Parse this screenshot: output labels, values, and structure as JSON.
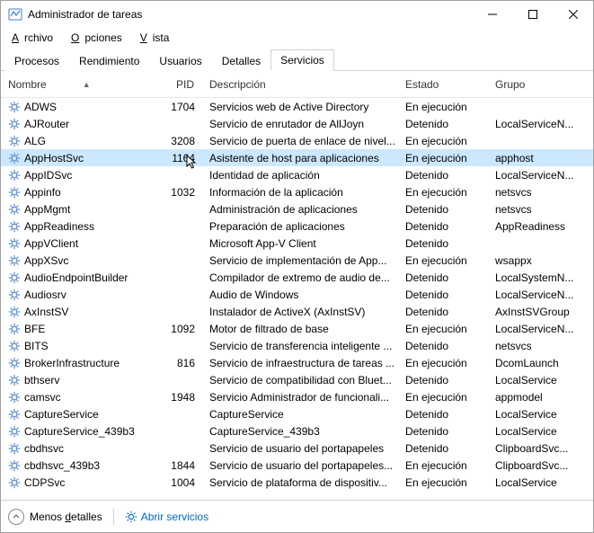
{
  "window": {
    "title": "Administrador de tareas"
  },
  "menu": {
    "file": "Archivo",
    "options": "Opciones",
    "view": "Vista"
  },
  "tabs": {
    "processes": "Procesos",
    "performance": "Rendimiento",
    "users": "Usuarios",
    "details": "Detalles",
    "services": "Servicios"
  },
  "columns": {
    "name": "Nombre",
    "pid": "PID",
    "description": "Descripción",
    "status": "Estado",
    "group": "Grupo"
  },
  "services": [
    {
      "name": "ADWS",
      "pid": "1704",
      "desc": "Servicios web de Active Directory",
      "status": "En ejecución",
      "group": ""
    },
    {
      "name": "AJRouter",
      "pid": "",
      "desc": "Servicio de enrutador de AllJoyn",
      "status": "Detenido",
      "group": "LocalServiceN..."
    },
    {
      "name": "ALG",
      "pid": "3208",
      "desc": "Servicio de puerta de enlace de nivel...",
      "status": "En ejecución",
      "group": ""
    },
    {
      "name": "AppHostSvc",
      "pid": "1164",
      "desc": "Asistente de host para aplicaciones",
      "status": "En ejecución",
      "group": "apphost",
      "selected": true
    },
    {
      "name": "AppIDSvc",
      "pid": "",
      "desc": "Identidad de aplicación",
      "status": "Detenido",
      "group": "LocalServiceN..."
    },
    {
      "name": "Appinfo",
      "pid": "1032",
      "desc": "Información de la aplicación",
      "status": "En ejecución",
      "group": "netsvcs"
    },
    {
      "name": "AppMgmt",
      "pid": "",
      "desc": "Administración de aplicaciones",
      "status": "Detenido",
      "group": "netsvcs"
    },
    {
      "name": "AppReadiness",
      "pid": "",
      "desc": "Preparación de aplicaciones",
      "status": "Detenido",
      "group": "AppReadiness"
    },
    {
      "name": "AppVClient",
      "pid": "",
      "desc": "Microsoft App-V Client",
      "status": "Detenido",
      "group": ""
    },
    {
      "name": "AppXSvc",
      "pid": "",
      "desc": "Servicio de implementación de App...",
      "status": "En ejecución",
      "group": "wsappx"
    },
    {
      "name": "AudioEndpointBuilder",
      "pid": "",
      "desc": "Compilador de extremo de audio de...",
      "status": "Detenido",
      "group": "LocalSystemN..."
    },
    {
      "name": "Audiosrv",
      "pid": "",
      "desc": "Audio de Windows",
      "status": "Detenido",
      "group": "LocalServiceN..."
    },
    {
      "name": "AxInstSV",
      "pid": "",
      "desc": "Instalador de ActiveX (AxInstSV)",
      "status": "Detenido",
      "group": "AxInstSVGroup"
    },
    {
      "name": "BFE",
      "pid": "1092",
      "desc": "Motor de filtrado de base",
      "status": "En ejecución",
      "group": "LocalServiceN..."
    },
    {
      "name": "BITS",
      "pid": "",
      "desc": "Servicio de transferencia inteligente ...",
      "status": "Detenido",
      "group": "netsvcs"
    },
    {
      "name": "BrokerInfrastructure",
      "pid": "816",
      "desc": "Servicio de infraestructura de tareas ...",
      "status": "En ejecución",
      "group": "DcomLaunch"
    },
    {
      "name": "bthserv",
      "pid": "",
      "desc": "Servicio de compatibilidad con Bluet...",
      "status": "Detenido",
      "group": "LocalService"
    },
    {
      "name": "camsvc",
      "pid": "1948",
      "desc": "Servicio Administrador de funcionali...",
      "status": "En ejecución",
      "group": "appmodel"
    },
    {
      "name": "CaptureService",
      "pid": "",
      "desc": "CaptureService",
      "status": "Detenido",
      "group": "LocalService"
    },
    {
      "name": "CaptureService_439b3",
      "pid": "",
      "desc": "CaptureService_439b3",
      "status": "Detenido",
      "group": "LocalService"
    },
    {
      "name": "cbdhsvc",
      "pid": "",
      "desc": "Servicio de usuario del portapapeles",
      "status": "Detenido",
      "group": "ClipboardSvc..."
    },
    {
      "name": "cbdhsvc_439b3",
      "pid": "1844",
      "desc": "Servicio de usuario del portapapeles...",
      "status": "En ejecución",
      "group": "ClipboardSvc..."
    },
    {
      "name": "CDPSvc",
      "pid": "1004",
      "desc": "Servicio de plataforma de dispositiv...",
      "status": "En ejecución",
      "group": "LocalService"
    }
  ],
  "footer": {
    "fewer": "Menos detalles",
    "open": "Abrir servicios"
  }
}
